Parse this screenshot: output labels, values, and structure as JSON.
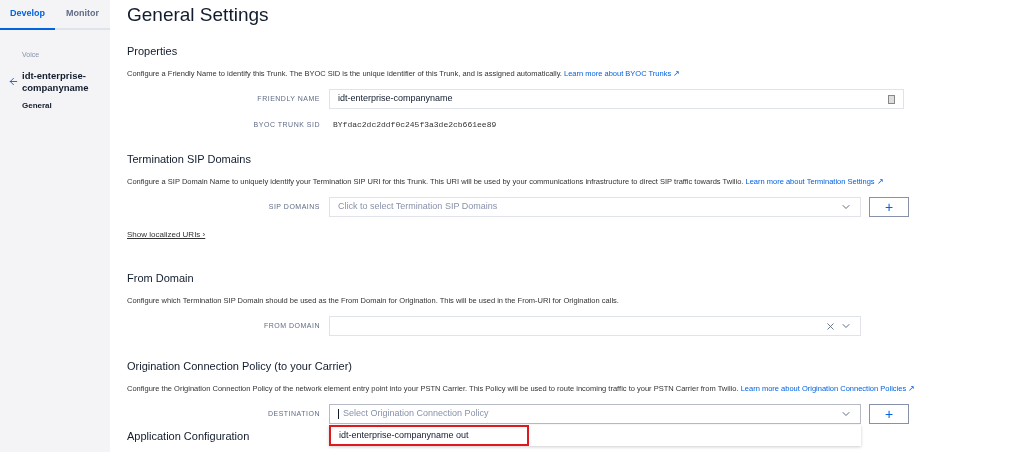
{
  "sidebar": {
    "tabs": [
      {
        "label": "Develop",
        "selected": true
      },
      {
        "label": "Monitor",
        "selected": false
      }
    ],
    "section": "Voice",
    "back_title": "idt-enterprise-companyname",
    "items": [
      {
        "label": "General",
        "selected": true
      }
    ]
  },
  "page_title": "General Settings",
  "sections": [
    {
      "heading": "Properties",
      "description": "Configure a Friendly Name to identify this Trunk. The BYOC SID is the unique identifier of this Trunk, and is assigned automatically.",
      "link": "Learn more about BYOC Trunks ↗",
      "fields": [
        {
          "kind": "input",
          "label": "FRIENDLY NAME",
          "value": "idt-enterprise-companyname"
        },
        {
          "kind": "text",
          "label": "BYOC TRUNK SID",
          "value": "BYfdac2dc2ddf0c245f3a3de2cb661ee89"
        }
      ]
    },
    {
      "heading": "Termination SIP Domains",
      "description": "Configure a SIP Domain Name to uniquely identify your Termination SIP URI for this Trunk. This URI will be used by your communications infrastructure to direct SIP traffic towards Twilio.",
      "link": "Learn more about Termination Settings ↗",
      "fields": [
        {
          "kind": "select",
          "label": "SIP DOMAINS",
          "placeholder": "Click to select Termination SIP Domains",
          "add_button": "+"
        }
      ],
      "footer_link": "Show localized URIs ›"
    },
    {
      "heading": "From Domain",
      "description": "Configure which Termination SIP Domain should be used as the From Domain for Origination. This will be used in the From-URI for Origination calls.",
      "fields": [
        {
          "kind": "select",
          "label": "FROM DOMAIN",
          "clearable": true
        }
      ]
    },
    {
      "heading": "Origination Connection Policy (to your Carrier)",
      "description": "Configure the Origination Connection Policy of the network element entry point into your PSTN Carrier. This Policy will be used to route incoming traffic to your PSTN Carrier from Twilio.",
      "link": "Learn more about Origination Connection Policies ↗",
      "fields": [
        {
          "kind": "select",
          "label": "DESTINATION",
          "placeholder": "Select Origination Connection Policy",
          "add_button": "+",
          "focused": true,
          "options": [
            {
              "label": "idt-enterprise-companyname out",
              "highlighted": true
            }
          ]
        }
      ]
    }
  ],
  "next_heading": "Application Configuration"
}
